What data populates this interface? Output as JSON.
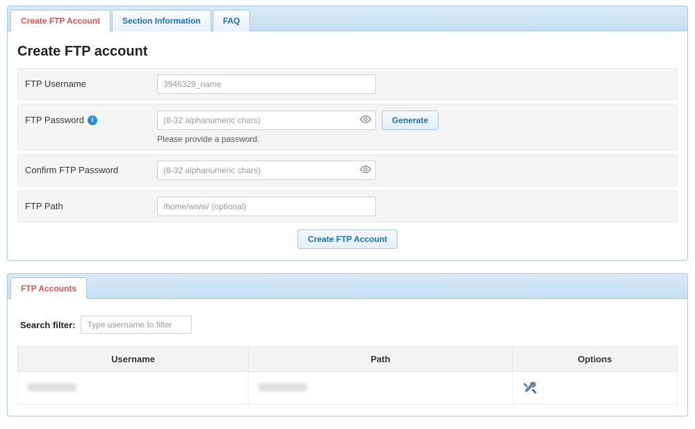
{
  "create_panel": {
    "tabs": [
      {
        "label": "Create FTP Account",
        "active": true
      },
      {
        "label": "Section Information",
        "active": false
      },
      {
        "label": "FAQ",
        "active": false
      }
    ],
    "title": "Create FTP account",
    "rows": {
      "username": {
        "label": "FTP Username",
        "placeholder": "3946329_name"
      },
      "password": {
        "label": "FTP Password",
        "placeholder": "(8-32 alphanumeric chars)",
        "generate_label": "Generate",
        "hint": "Please provide a password."
      },
      "confirm": {
        "label": "Confirm FTP Password",
        "placeholder": "(8-32 alphanumeric chars)"
      },
      "path": {
        "label": "FTP Path",
        "placeholder": "/home/www/ (optional)"
      }
    },
    "submit_label": "Create FTP Account"
  },
  "accounts_panel": {
    "tabs": [
      {
        "label": "FTP Accounts",
        "active": true
      }
    ],
    "search": {
      "label": "Search filter:",
      "placeholder": "Type username to filter"
    },
    "columns": {
      "username": "Username",
      "path": "Path",
      "options": "Options"
    },
    "rows": [
      {
        "username": "",
        "path": ""
      }
    ]
  }
}
